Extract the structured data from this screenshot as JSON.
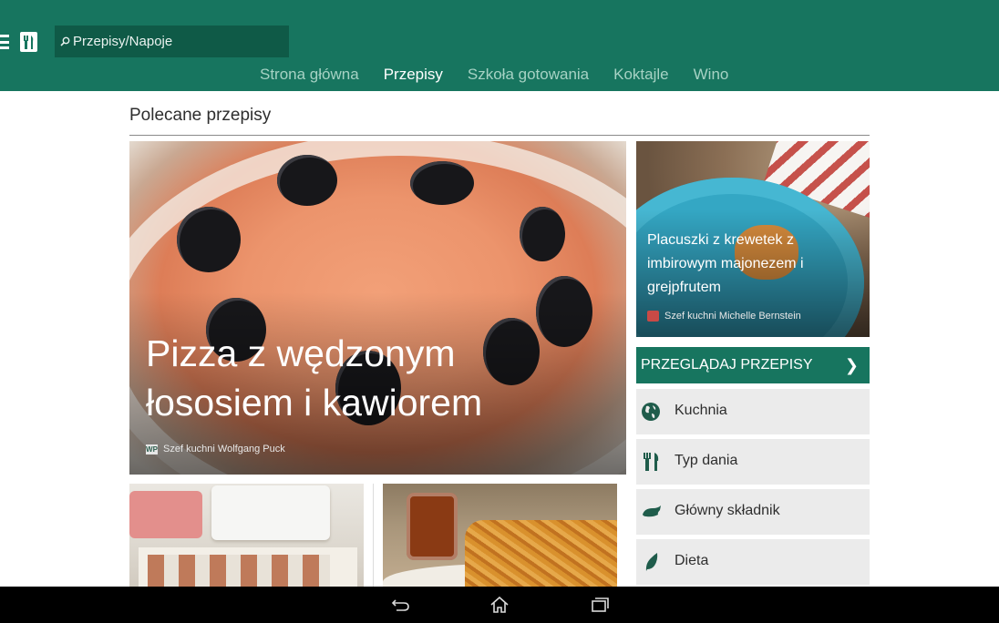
{
  "header": {
    "search": {
      "value": "",
      "placeholder": "Przepisy/Napoje"
    },
    "tabs": [
      {
        "label": "Strona główna",
        "active": false
      },
      {
        "label": "Przepisy",
        "active": true
      },
      {
        "label": "Szkoła gotowania",
        "active": false
      },
      {
        "label": "Koktajle",
        "active": false
      },
      {
        "label": "Wino",
        "active": false
      }
    ]
  },
  "main": {
    "section_title": "Polecane przepisy",
    "hero": {
      "title": "Pizza z wędzonym łososiem i kawiorem",
      "author": "Szef kuchni Wolfgang Puck"
    },
    "side_card": {
      "title": "Placuszki z krewetek z imbirowym majonezem i grejpfrutem",
      "author": "Szef kuchni Michelle Bernstein"
    },
    "browse": {
      "header": "PRZEGLĄDAJ PRZEPISY",
      "items": [
        {
          "label": "Kuchnia",
          "icon": "globe-icon"
        },
        {
          "label": "Typ dania",
          "icon": "utensils-icon"
        },
        {
          "label": "Główny składnik",
          "icon": "ingredient-icon"
        },
        {
          "label": "Dieta",
          "icon": "leaf-icon"
        }
      ]
    }
  },
  "colors": {
    "brand_green": "#17755f",
    "search_bg": "#0f5a47",
    "nav_inactive": "#a6d2c4",
    "browse_item_bg": "#ebebeb",
    "system_bar": "#000000"
  },
  "system_bar": {
    "icons": [
      "back-icon",
      "home-icon",
      "recent-apps-icon"
    ]
  }
}
